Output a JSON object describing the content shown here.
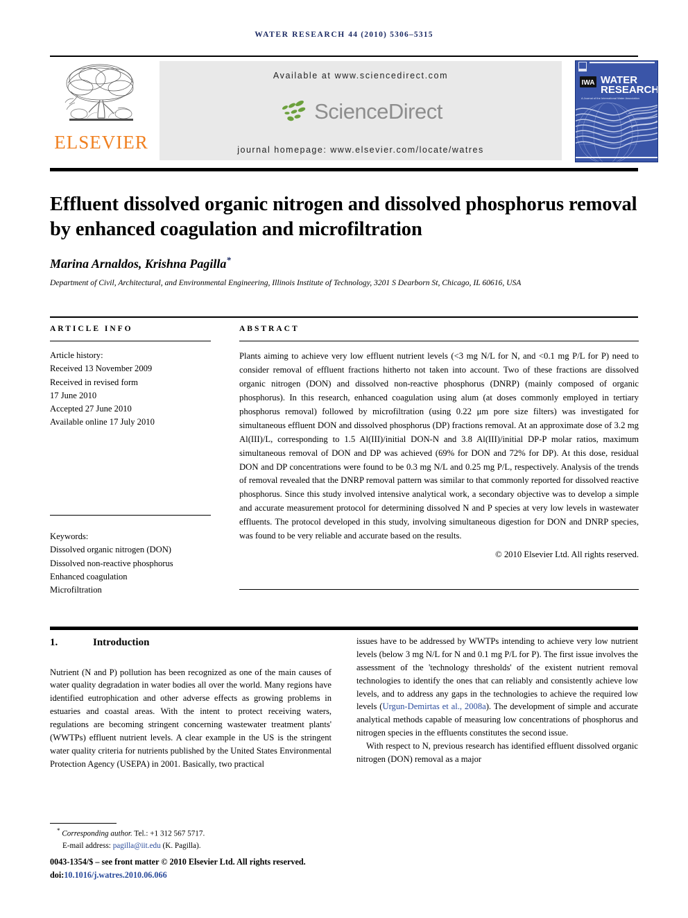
{
  "running_head": {
    "journal": "WATER RESEARCH",
    "rest": "44 (2010) 5306–5315"
  },
  "publisher_band": {
    "elsevier_wordmark": "ELSEVIER",
    "available_at": "Available at www.sciencedirect.com",
    "sciencedirect_wordmark": "ScienceDirect",
    "journal_homepage": "journal homepage: www.elsevier.com/locate/watres",
    "cover": {
      "line1": "WATER",
      "line2": "RESEARCH",
      "society_line": "A Journal of the International Water Association",
      "badge": "IWA"
    },
    "colors": {
      "elsevier_orange": "#f08020",
      "sciencedirect_green": "#6ba03c",
      "sciencedirect_gray": "#8d8d8d",
      "cover_blue": "#3a55a8",
      "running_head_navy": "#1b2a63",
      "panel_gray": "#e9e9e9"
    }
  },
  "article": {
    "title": "Effluent dissolved organic nitrogen and dissolved phosphorus removal by enhanced coagulation and microfiltration",
    "authors": "Marina Arnaldos, Krishna Pagilla",
    "author_marker": "*",
    "affiliation": "Department of Civil, Architectural, and Environmental Engineering, Illinois Institute of Technology, 3201 S Dearborn St, Chicago, IL 60616, USA"
  },
  "article_info": {
    "heading": "ARTICLE INFO",
    "history_label": "Article history:",
    "history": [
      "Received 13 November 2009",
      "Received in revised form",
      "17 June 2010",
      "Accepted 27 June 2010",
      "Available online 17 July 2010"
    ],
    "keywords_label": "Keywords:",
    "keywords": [
      "Dissolved organic nitrogen (DON)",
      "Dissolved non-reactive phosphorus",
      "Enhanced coagulation",
      "Microfiltration"
    ]
  },
  "abstract": {
    "heading": "ABSTRACT",
    "text": "Plants aiming to achieve very low effluent nutrient levels (<3 mg N/L for N, and <0.1 mg P/L for P) need to consider removal of effluent fractions hitherto not taken into account. Two of these fractions are dissolved organic nitrogen (DON) and dissolved non-reactive phosphorus (DNRP) (mainly composed of organic phosphorus). In this research, enhanced coagulation using alum (at doses commonly employed in tertiary phosphorus removal) followed by microfiltration (using 0.22 μm pore size filters) was investigated for simultaneous effluent DON and dissolved phosphorus (DP) fractions removal. At an approximate dose of 3.2 mg Al(III)/L, corresponding to 1.5 Al(III)/initial DON-N and 3.8 Al(III)/initial DP-P molar ratios, maximum simultaneous removal of DON and DP was achieved (69% for DON and 72% for DP). At this dose, residual DON and DP concentrations were found to be 0.3 mg N/L and 0.25 mg P/L, respectively. Analysis of the trends of removal revealed that the DNRP removal pattern was similar to that commonly reported for dissolved reactive phosphorus. Since this study involved intensive analytical work, a secondary objective was to develop a simple and accurate measurement protocol for determining dissolved N and P species at very low levels in wastewater effluents. The protocol developed in this study, involving simultaneous digestion for DON and DNRP species, was found to be very reliable and accurate based on the results.",
    "copyright": "© 2010 Elsevier Ltd. All rights reserved."
  },
  "body": {
    "section_number": "1.",
    "section_title": "Introduction",
    "left_paragraph": "Nutrient (N and P) pollution has been recognized as one of the main causes of water quality degradation in water bodies all over the world. Many regions have identified eutrophication and other adverse effects as growing problems in estuaries and coastal areas. With the intent to protect receiving waters, regulations are becoming stringent concerning wastewater treatment plants' (WWTPs) effluent nutrient levels. A clear example in the US is the stringent water quality criteria for nutrients published by the United States Environmental Protection Agency (USEPA) in 2001. Basically, two practical",
    "right_paragraph_part1": "issues have to be addressed by WWTPs intending to achieve very low nutrient levels (below 3 mg N/L for N and 0.1 mg P/L for P). The first issue involves the assessment of the 'technology thresholds' of the existent nutrient removal technologies to identify the ones that can reliably and consistently achieve low levels, and to address any gaps in the technologies to achieve the required low levels (",
    "right_citation": "Urgun-Demirtas et al., 2008a",
    "right_paragraph_part2": "). The development of simple and accurate analytical methods capable of measuring low concentrations of phosphorus and nitrogen species in the effluents constitutes the second issue.",
    "right_paragraph2": "With respect to N, previous research has identified effluent dissolved organic nitrogen (DON) removal as a major"
  },
  "footnotes": {
    "corresponding_label": "Corresponding author.",
    "corresponding_tel": " Tel.: +1 312 567 5717.",
    "email_label": "E-mail address:",
    "email": "pagilla@iit.edu",
    "email_suffix": "(K. Pagilla).",
    "issn_line": "0043-1354/$ – see front matter © 2010 Elsevier Ltd. All rights reserved.",
    "doi_prefix": "doi:",
    "doi": "10.1016/j.watres.2010.06.066"
  }
}
